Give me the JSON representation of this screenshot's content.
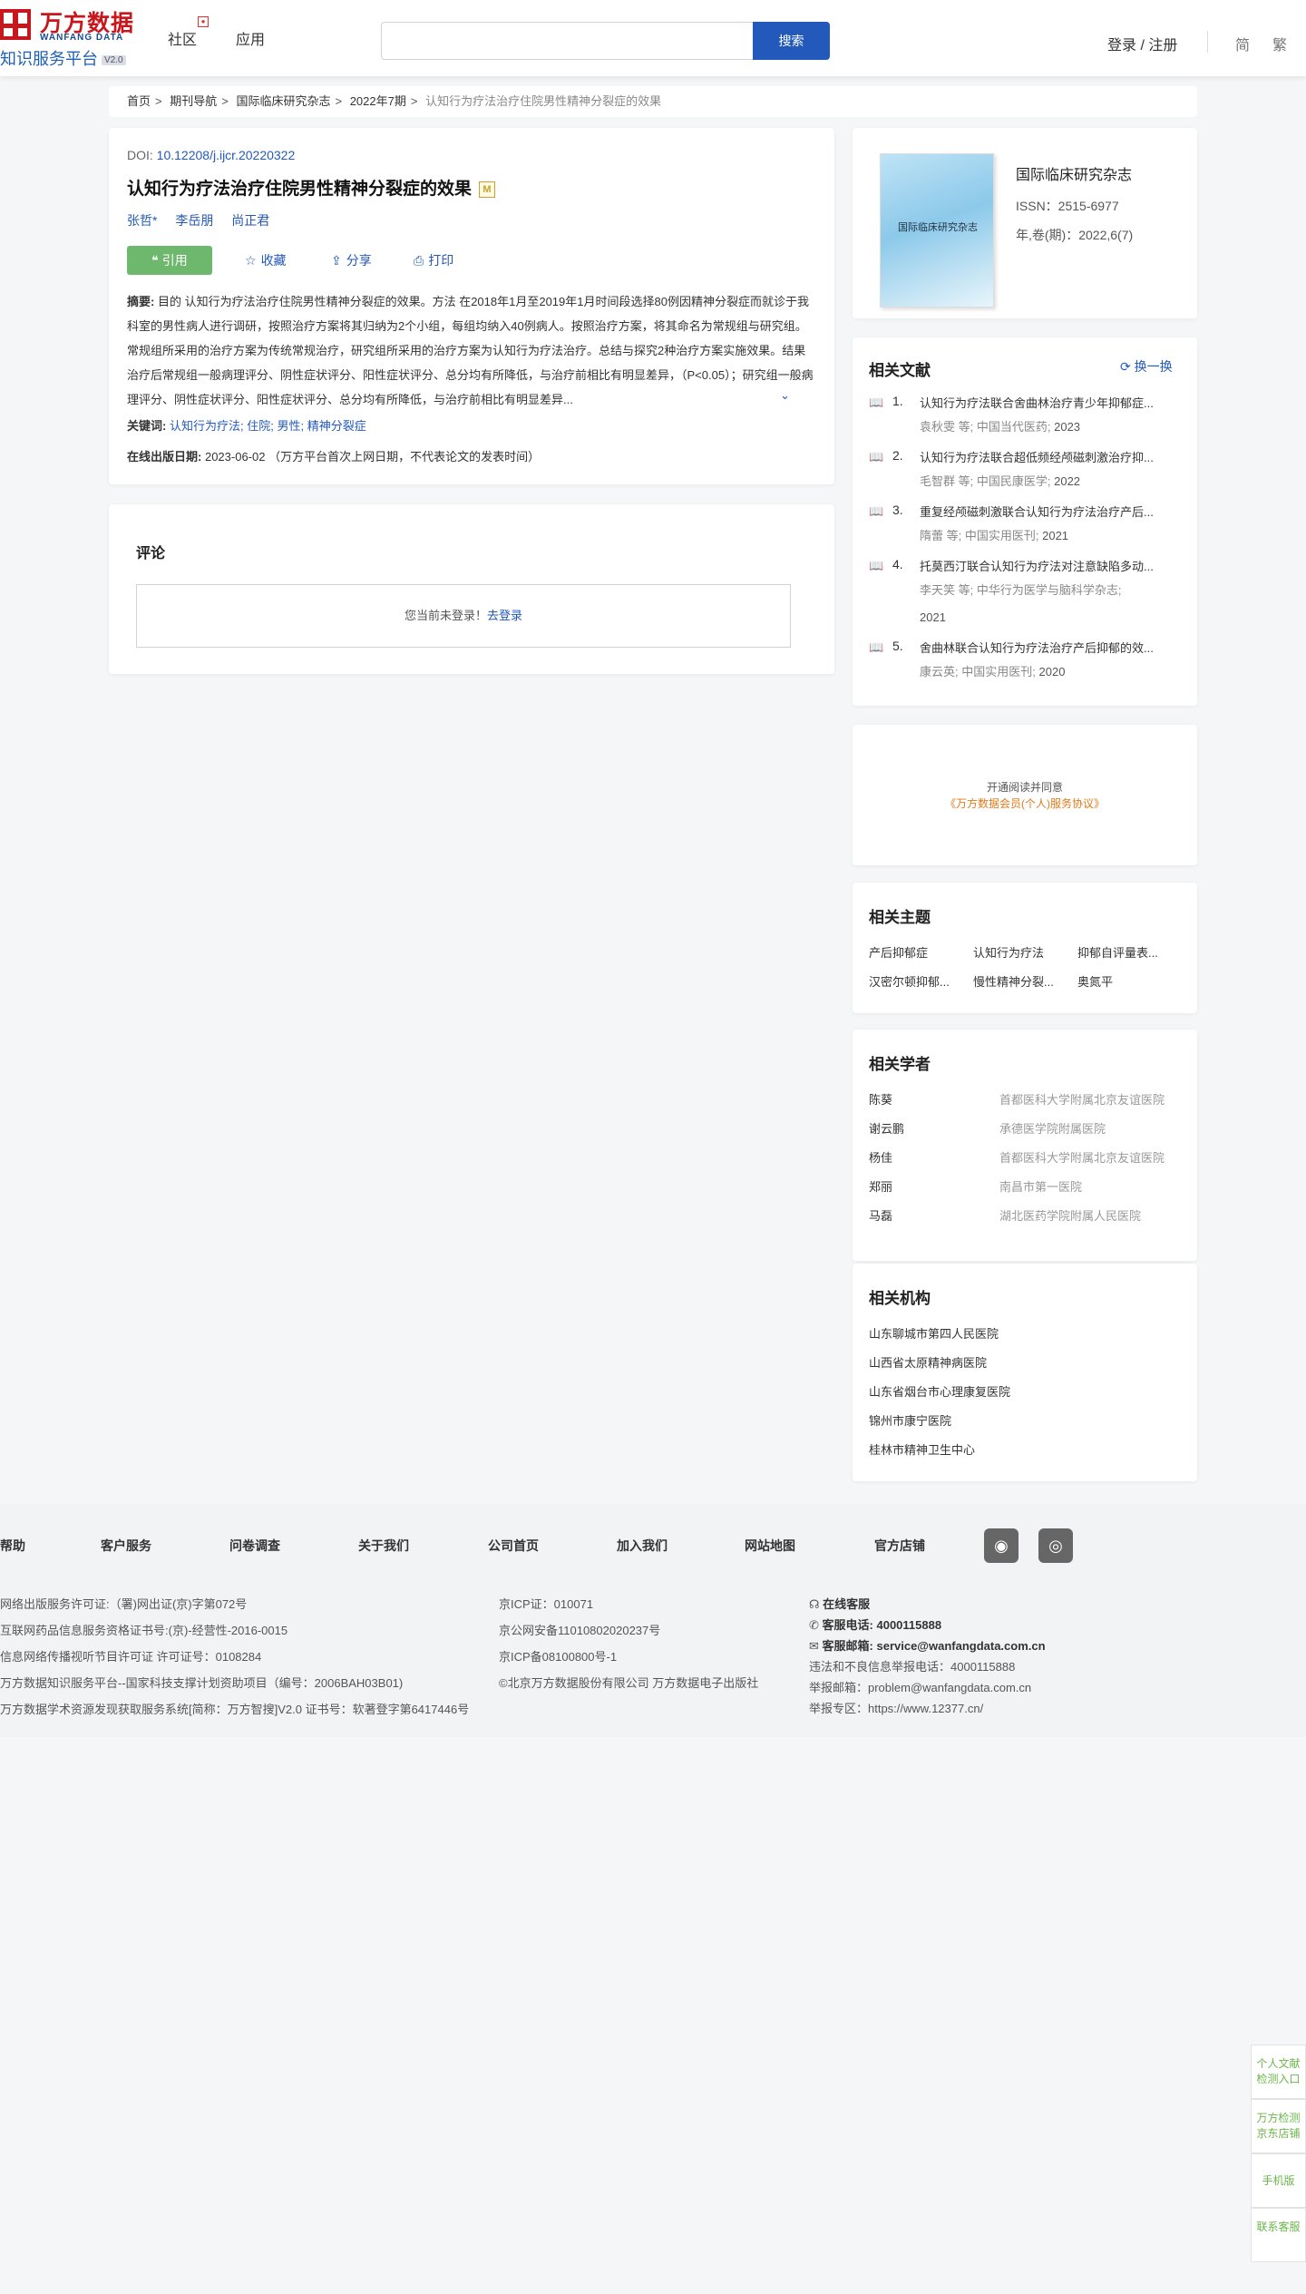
{
  "header": {
    "logo_cn": "万方数据",
    "logo_en": "WANFANG DATA",
    "platform": "知识服务平台",
    "version": "V2.0",
    "nav": [
      "社区",
      "应用"
    ],
    "search_button": "搜索",
    "search_placeholder": "",
    "login": "登录 / 注册",
    "lang_simplified": "简",
    "lang_traditional": "繁"
  },
  "breadcrumb": {
    "items": [
      "首页",
      "期刊导航",
      "国际临床研究杂志",
      "2022年7期"
    ],
    "current": "认知行为疗法治疗住院男性精神分裂症的效果",
    "sep": ">"
  },
  "article": {
    "doi_label": "DOI: ",
    "doi": "10.12208/j.ijcr.20220322",
    "title": "认知行为疗法治疗住院男性精神分裂症的效果",
    "title_badge": "M",
    "authors": [
      "张哲*",
      "李岳朋",
      "尚正君"
    ],
    "actions": {
      "cite": "引用",
      "favorite": "收藏",
      "share": "分享",
      "print": "打印"
    },
    "abstract_label": "摘要:",
    "abstract": "目的 认知行为疗法治疗住院男性精神分裂症的效果。方法 在2018年1月至2019年1月时间段选择80例因精神分裂症而就诊于我科室的男性病人进行调研，按照治疗方案将其归纳为2个小组，每组均纳入40例病人。按照治疗方案，将其命名为常规组与研究组。常规组所采用的治疗方案为传统常规治疗，研究组所采用的治疗方案为认知行为疗法治疗。总结与探究2种治疗方案实施效果。结果 治疗后常规组一般病理评分、阴性症状评分、阳性症状评分、总分均有所降低，与治疗前相比有明显差异，（P<0.05）；研究组一般病理评分、阴性症状评分、阳性症状评分、总分均有所降低，与治疗前相比有明显差异...",
    "keywords_label": "关键词:",
    "keywords": [
      "认知行为疗法;",
      "住院;",
      "男性;",
      "精神分裂症"
    ],
    "date_label": "在线出版日期:",
    "date": "2023-06-02",
    "date_note": "（万方平台首次上网日期，不代表论文的发表时间）"
  },
  "comments": {
    "title": "评论",
    "not_logged": "您当前未登录！",
    "login_link": "去登录"
  },
  "journal": {
    "name": "国际临床研究杂志",
    "cover_text": "国际临床研究杂志",
    "issn": "ISSN：2515-6977",
    "issue": "年,卷(期)：2022,6(7)"
  },
  "related_docs": {
    "title": "相关文献",
    "switch": "换一换",
    "items": [
      {
        "num": "1.",
        "title": "认知行为疗法联合舍曲林治疗青少年抑郁症...",
        "authors": "袁秋雯  等;",
        "source": "中国当代医药;",
        "year": "2023"
      },
      {
        "num": "2.",
        "title": "认知行为疗法联合超低频经颅磁刺激治疗抑...",
        "authors": "毛智群  等;",
        "source": "中国民康医学;",
        "year": "2022"
      },
      {
        "num": "3.",
        "title": "重复经颅磁刺激联合认知行为疗法治疗产后...",
        "authors": "隋蕾  等;",
        "source": "中国实用医刊;",
        "year": "2021"
      },
      {
        "num": "4.",
        "title": "托莫西汀联合认知行为疗法对注意缺陷多动...",
        "authors": "李天笑  等;",
        "source": "中华行为医学与脑科学杂志;",
        "year": "2021"
      },
      {
        "num": "5.",
        "title": "舍曲林联合认知行为疗法治疗产后抑郁的效...",
        "authors": "康云英;",
        "source": "中国实用医刊;",
        "year": "2020"
      }
    ]
  },
  "open_read": {
    "line1": "开通阅读并同意",
    "line2": "《万方数据会员(个人)服务协议》"
  },
  "topics": {
    "title": "相关主题",
    "items": [
      "产后抑郁症",
      "认知行为疗法",
      "抑郁自评量表...",
      "汉密尔顿抑郁...",
      "慢性精神分裂...",
      "奥氮平"
    ]
  },
  "scholars": {
    "title": "相关学者",
    "items": [
      {
        "name": "陈葵",
        "org": "首都医科大学附属北京友谊医院"
      },
      {
        "name": "谢云鹏",
        "org": "承德医学院附属医院"
      },
      {
        "name": "杨佳",
        "org": "首都医科大学附属北京友谊医院"
      },
      {
        "name": "郑丽",
        "org": "南昌市第一医院"
      },
      {
        "name": "马磊",
        "org": "湖北医药学院附属人民医院"
      }
    ]
  },
  "orgs": {
    "title": "相关机构",
    "items": [
      "山东聊城市第四人民医院",
      "山西省太原精神病医院",
      "山东省烟台市心理康复医院",
      "锦州市康宁医院",
      "桂林市精神卫生中心"
    ]
  },
  "footer": {
    "nav": [
      "帮助",
      "客户服务",
      "问卷调查",
      "关于我们",
      "公司首页",
      "加入我们",
      "网站地图",
      "官方店铺"
    ],
    "col1": [
      "网络出版服务许可证:（署)网出证(京)字第072号",
      "互联网药品信息服务资格证书号:(京)-经营性-2016-0015",
      "信息网络传播视听节目许可证 许可证号：0108284",
      "万方数据知识服务平台--国家科技支撑计划资助项目（编号：2006BAH03B01)",
      "万方数据学术资源发现获取服务系统[简称：万方智搜]V2.0 证书号：软著登字第6417446号"
    ],
    "col2": [
      "京ICP证：010071",
      "京公网安备11010802020237号",
      "京ICP备08100800号-1",
      "©北京万方数据股份有限公司 万方数据电子出版社"
    ],
    "online_service": "在线客服",
    "phone_label": "客服电话:",
    "phone": "4000115888",
    "email_label": "客服邮箱:",
    "email": "service@wanfangdata.com.cn",
    "col3": [
      "违法和不良信息举报电话：4000115888",
      "举报邮箱：problem@wanfangdata.com.cn",
      "举报专区：https://www.12377.cn/"
    ]
  },
  "side_tools": [
    "个人文献检测入口",
    "万方检测京东店铺",
    "手机版",
    "联系客服"
  ]
}
